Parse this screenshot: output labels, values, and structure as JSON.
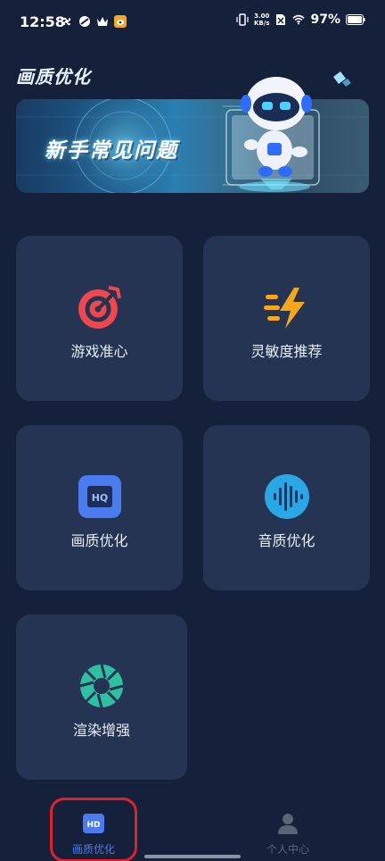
{
  "status_bar": {
    "time": "12:58",
    "net_speed_value": "3.00",
    "net_speed_unit": "KB/s",
    "battery": "97%"
  },
  "header": {
    "title": "画质优化"
  },
  "banner": {
    "text": "新手常见问题"
  },
  "cards": [
    {
      "label": "游戏准心",
      "icon": "target-icon",
      "color": "#f0474e"
    },
    {
      "label": "灵敏度推荐",
      "icon": "lightning-icon",
      "color": "#f7a719"
    },
    {
      "label": "画质优化",
      "icon": "hq-icon",
      "color": "#4a7cf0"
    },
    {
      "label": "音质优化",
      "icon": "sound-wave-icon",
      "color": "#2aa8e6"
    },
    {
      "label": "渲染增强",
      "icon": "aperture-icon",
      "color": "#2fbfa2"
    }
  ],
  "bottom_nav": {
    "items": [
      {
        "label": "画质优化",
        "icon": "hd-icon",
        "active": true,
        "color": "#4a7cf0"
      },
      {
        "label": "个人中心",
        "icon": "user-icon",
        "active": false,
        "color": "#5a6478"
      }
    ]
  }
}
